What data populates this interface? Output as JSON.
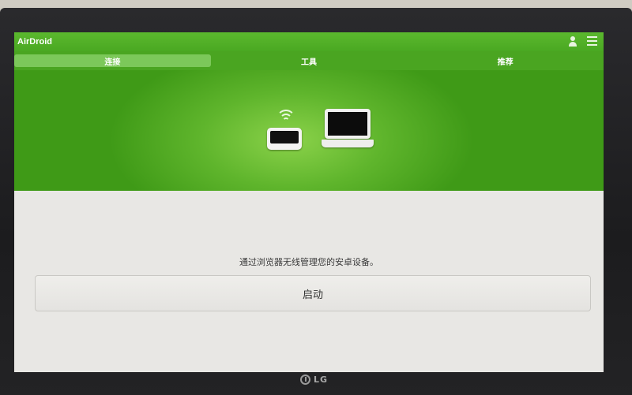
{
  "app": {
    "title": "AirDroid"
  },
  "header_icons": [
    "user-icon",
    "menu-icon"
  ],
  "tabs": [
    {
      "label": "连接",
      "active": true
    },
    {
      "label": "工具",
      "active": false
    },
    {
      "label": "推荐",
      "active": false
    }
  ],
  "main": {
    "description": "通过浏览器无线管理您的安卓设备。",
    "start_button": "启动"
  },
  "tv": {
    "brand": "LG"
  },
  "colors": {
    "accent": "#4aa822",
    "active_tab": "#7cc85a"
  }
}
